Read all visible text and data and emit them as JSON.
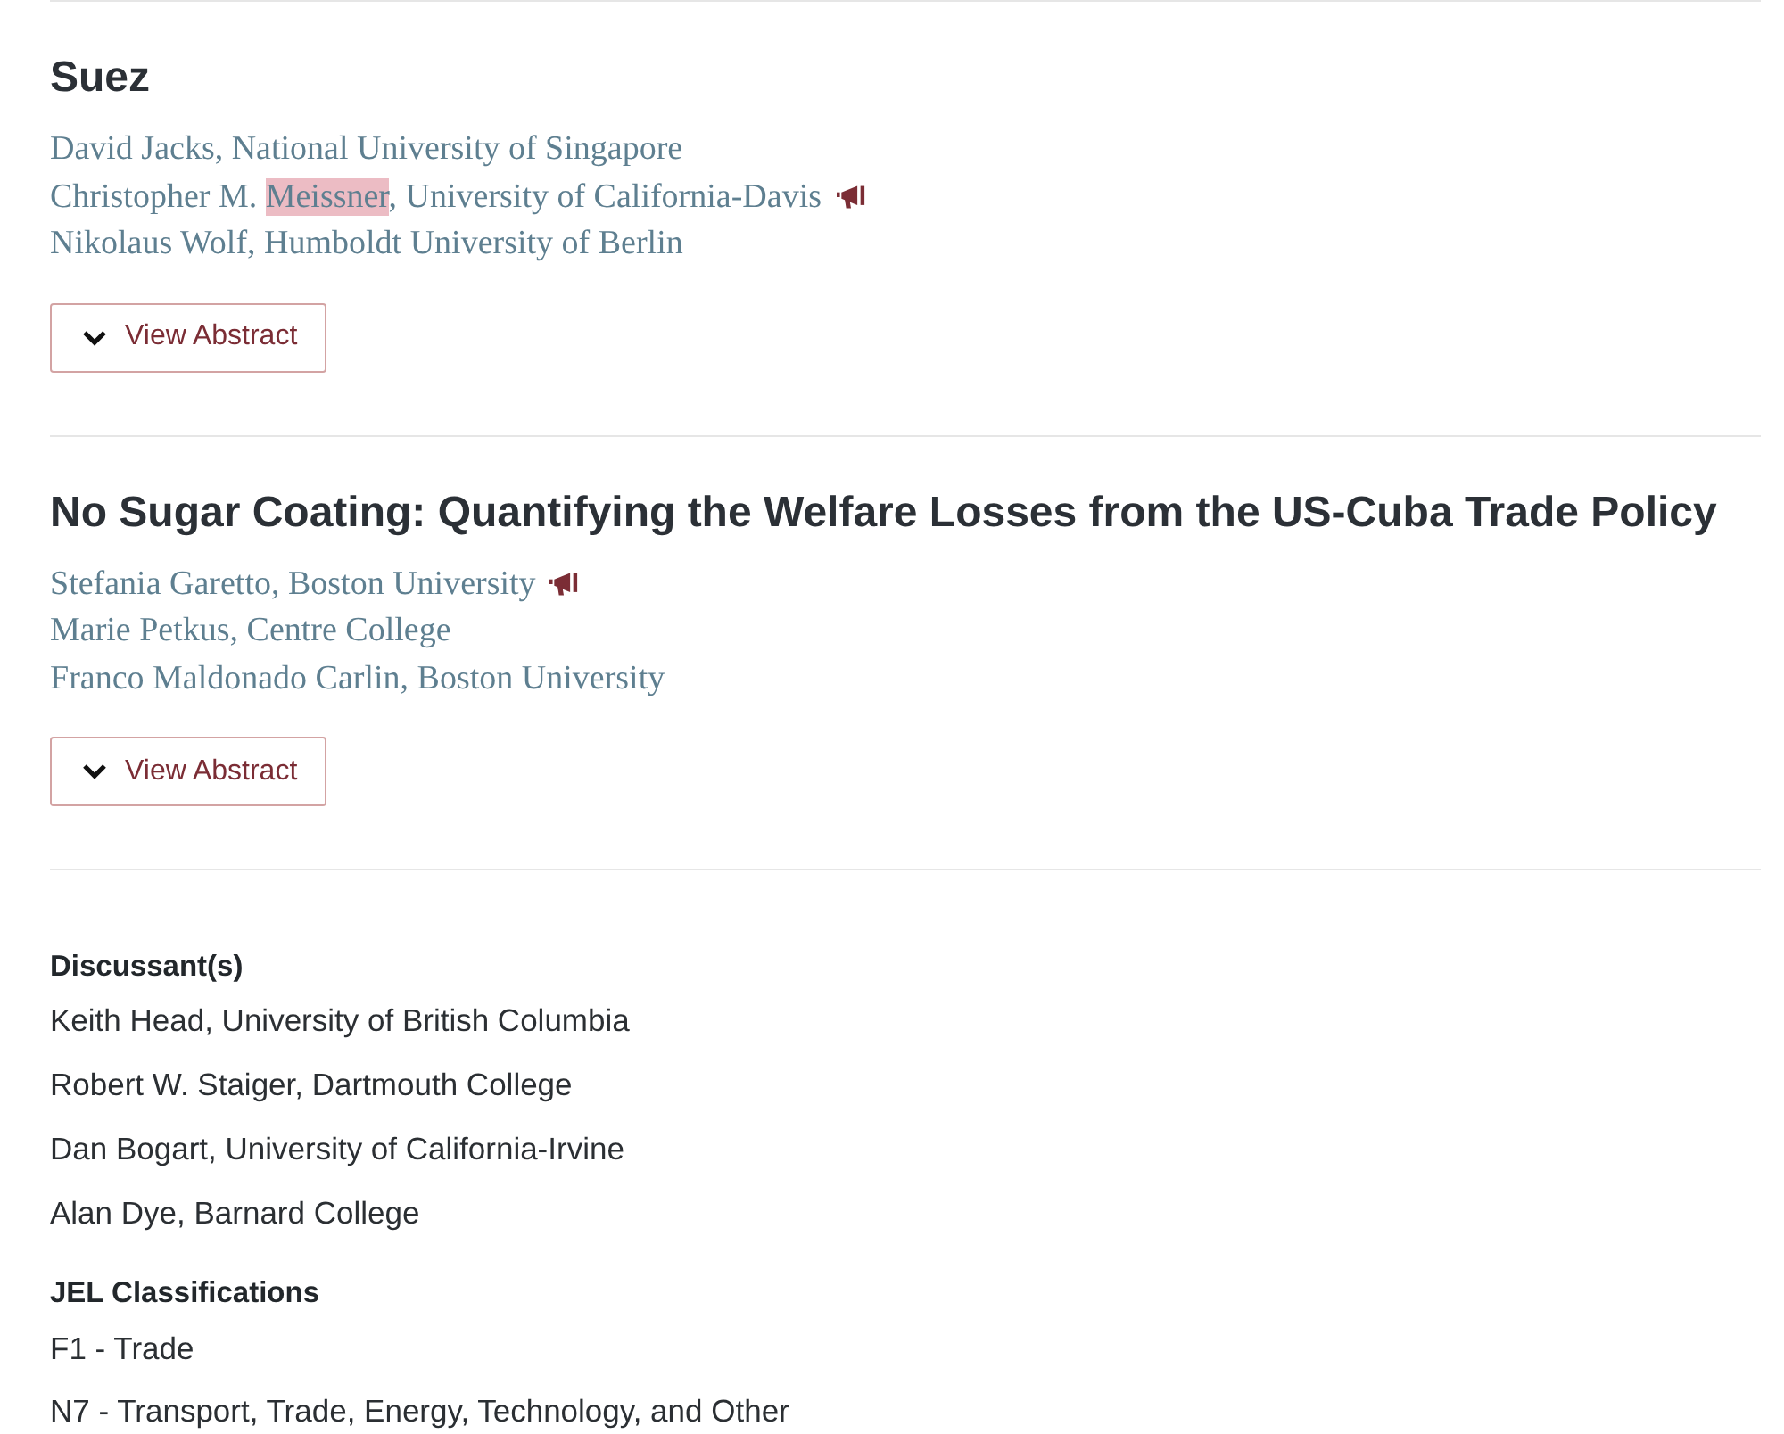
{
  "papers": [
    {
      "title": "Suez",
      "authors": [
        {
          "segments": [
            {
              "text": "David Jacks, National University of Singapore",
              "highlighted": false
            }
          ],
          "presenter": false
        },
        {
          "segments": [
            {
              "text": "Christopher M. ",
              "highlighted": false
            },
            {
              "text": "Meissner",
              "highlighted": true
            },
            {
              "text": ", University of California-Davis",
              "highlighted": false
            }
          ],
          "presenter": true
        },
        {
          "segments": [
            {
              "text": "Nikolaus Wolf, Humboldt University of Berlin",
              "highlighted": false
            }
          ],
          "presenter": false
        }
      ],
      "button": "View Abstract"
    },
    {
      "title": "No Sugar Coating: Quantifying the Welfare Losses from the US-Cuba Trade Policy",
      "authors": [
        {
          "segments": [
            {
              "text": "Stefania Garetto, Boston University",
              "highlighted": false
            }
          ],
          "presenter": true
        },
        {
          "segments": [
            {
              "text": "Marie Petkus, Centre College",
              "highlighted": false
            }
          ],
          "presenter": false
        },
        {
          "segments": [
            {
              "text": "Franco Maldonado Carlin, Boston University",
              "highlighted": false
            }
          ],
          "presenter": false
        }
      ],
      "button": "View Abstract"
    }
  ],
  "discussants": {
    "heading": "Discussant(s)",
    "items": [
      "Keith Head, University of British Columbia",
      "Robert W. Staiger, Dartmouth College",
      "Dan Bogart, University of California-Irvine",
      "Alan Dye, Barnard College"
    ]
  },
  "jel": {
    "heading": "JEL Classifications",
    "items": [
      "F1 - Trade",
      "N7 - Transport, Trade, Energy, Technology, and Other"
    ]
  }
}
